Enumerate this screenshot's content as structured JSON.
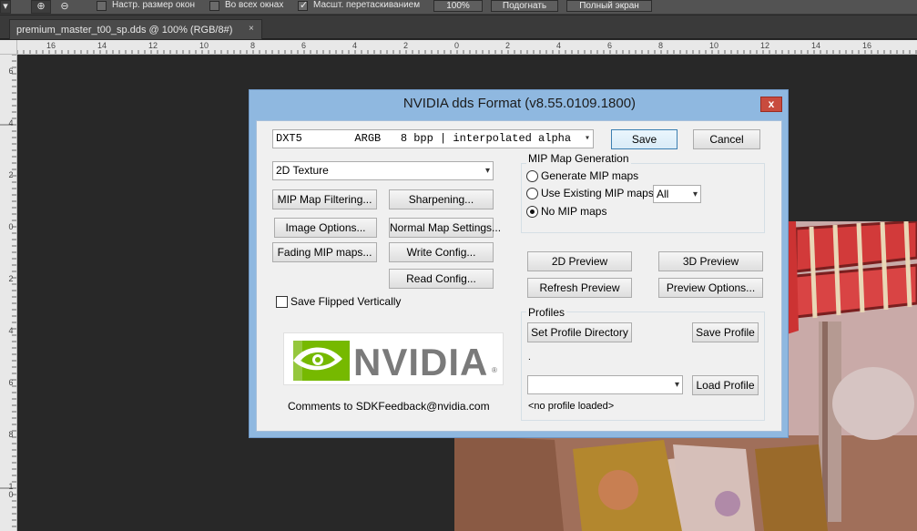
{
  "options_bar": {
    "checkbox_resize_label": "Настр. размер окон",
    "checkbox_all_windows_label": "Во всех окнах",
    "checkbox_scrubby_label": "Масшт. перетаскиванием",
    "btn_100_label": "100%",
    "btn_fit_label": "Подогнать",
    "btn_fullscreen_label": "Полный экран"
  },
  "document": {
    "tab_label": "premium_master_t00_sp.dds @ 100% (RGB/8#)",
    "close_glyph": "×"
  },
  "ruler": {
    "top_labels": [
      "16",
      "14",
      "12",
      "10",
      "8",
      "6",
      "4",
      "2",
      "0",
      "2",
      "4",
      "6",
      "8",
      "10",
      "12",
      "14",
      "16"
    ],
    "left_labels": [
      "6",
      "4",
      "2",
      "0",
      "2",
      "4",
      "6",
      "8",
      "10"
    ]
  },
  "dialog": {
    "title": "NVIDIA dds Format (v8.55.0109.1800)",
    "close_glyph": "x",
    "format_combo": "DXT5        ARGB   8 bpp | interpolated alpha",
    "save_label": "Save",
    "cancel_label": "Cancel",
    "texture_type": "2D Texture",
    "mip_filtering_label": "MIP Map Filtering...",
    "sharpening_label": "Sharpening...",
    "image_options_label": "Image Options...",
    "normal_map_label": "Normal Map Settings...",
    "fading_mip_label": "Fading MIP maps...",
    "write_config_label": "Write Config...",
    "read_config_label": "Read Config...",
    "save_flipped_label": "Save Flipped Vertically",
    "logo_text": "NVIDIA",
    "comments_text": "Comments to SDKFeedback@nvidia.com",
    "mip_group_title": "MIP Map Generation",
    "radio_generate": "Generate MIP maps",
    "radio_use_existing": "Use Existing MIP maps",
    "existing_select_value": "All",
    "radio_no_mip": "No MIP maps",
    "preview_2d_label": "2D Preview",
    "preview_3d_label": "3D Preview",
    "refresh_preview_label": "Refresh Preview",
    "preview_options_label": "Preview Options...",
    "profiles_group_title": "Profiles",
    "set_profile_dir_label": "Set Profile Directory",
    "save_profile_label": "Save Profile",
    "profile_path": ".",
    "load_profile_label": "Load Profile",
    "profile_status": "<no profile loaded>",
    "selected_mip_option": "No MIP maps"
  },
  "colors": {
    "dialog_frame": "#8fb8e0",
    "close_button": "#c84b3e",
    "nvidia_green": "#76b900"
  }
}
